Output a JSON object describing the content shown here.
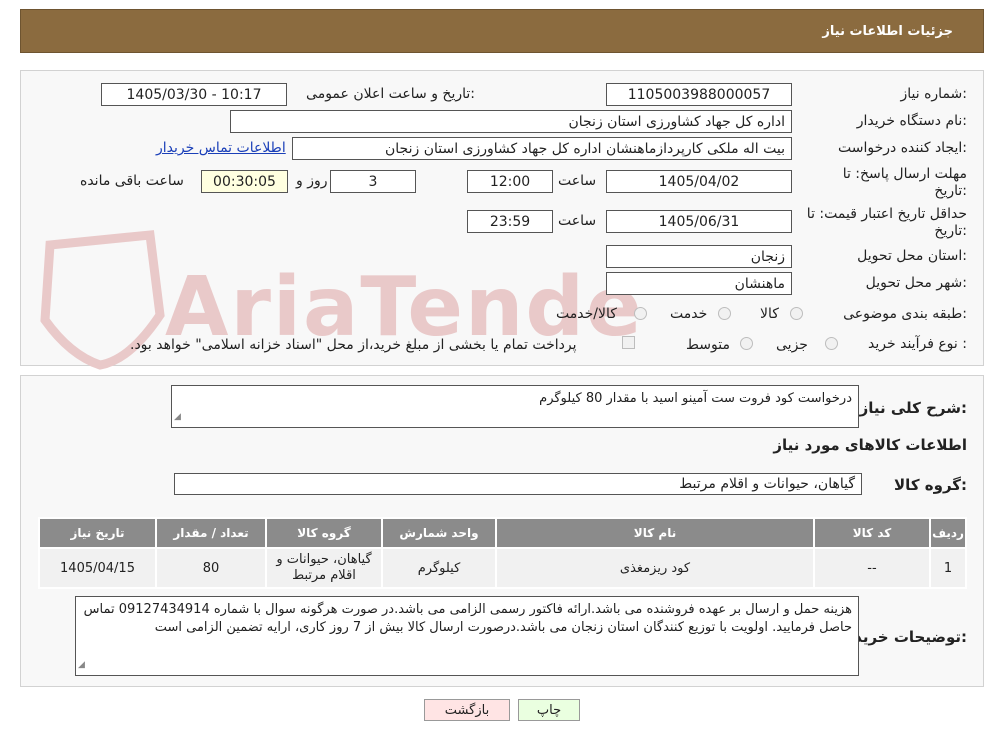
{
  "header": {
    "title": "جزئیات اطلاعات نیاز"
  },
  "watermark": {
    "text": "AriaTender.neT"
  },
  "fields": {
    "need_number_label": "شماره نیاز:",
    "need_number": "1105003988000057",
    "announce_label": "تاریخ و ساعت اعلان عمومی:",
    "announce_value": "1405/03/30 - 10:17",
    "buyer_org_label": "نام دستگاه خریدار:",
    "buyer_org": "اداره کل جهاد کشاورزی استان زنجان",
    "creator_label": "ایجاد کننده درخواست:",
    "creator": "بیت اله ملکی کارپردازماهنشان اداره کل جهاد کشاورزی استان زنجان",
    "buyer_contact_link": "اطلاعات تماس خریدار",
    "deadline_label_1": "مهلت ارسال پاسخ: تا",
    "deadline_label_2": "تاریخ:",
    "deadline_date": "1405/04/02",
    "time_label": "ساعت",
    "deadline_time": "12:00",
    "days_value": "3",
    "days_label": "روز و",
    "remaining_time": "00:30:05",
    "remaining_label": "ساعت باقی مانده",
    "price_valid_label_1": "حداقل تاریخ اعتبار قیمت: تا",
    "price_valid_label_2": "تاریخ:",
    "price_valid_date": "1405/06/31",
    "price_valid_time": "23:59",
    "province_label": "استان محل تحویل:",
    "province": "زنجان",
    "city_label": "شهر محل تحویل:",
    "city": "ماهنشان",
    "category_label": "طبقه بندی موضوعی:",
    "category_options": [
      "کالا",
      "خدمت",
      "کالا/خدمت"
    ],
    "process_label": "نوع فرآیند خرید :",
    "process_options": [
      "جزیی",
      "متوسط"
    ],
    "treasury_note": "پرداخت تمام یا بخشی از مبلغ خرید،از محل \"اسناد خزانه اسلامی\" خواهد بود."
  },
  "description": {
    "label": "شرح کلی نیاز:",
    "text": "درخواست کود فروت ست آمینو اسید با مقدار 80 کیلوگرم"
  },
  "goods": {
    "section_title": "اطلاعات کالاهای مورد نیاز",
    "group_label": "گروه کالا:",
    "group_value": "گیاهان، حیوانات و اقلام مرتبط",
    "columns": [
      "ردیف",
      "کد کالا",
      "نام کالا",
      "واحد شمارش",
      "گروه کالا",
      "تعداد / مقدار",
      "تاریخ نیاز"
    ],
    "rows": [
      [
        "1",
        "--",
        "کود ریزمغذی",
        "کیلوگرم",
        "گیاهان، حیوانات و اقلام مرتبط",
        "80",
        "1405/04/15"
      ]
    ]
  },
  "buyer_notes": {
    "label": "توضیحات خریدار:",
    "text": "هزینه حمل و ارسال بر عهده فروشنده می باشد.ارائه فاکتور رسمی الزامی می باشد.در صورت هرگونه سوال با شماره 09127434914 تماس حاصل فرمایید. اولویت با توزیع کنندگان استان زنجان می باشد.درصورت ارسال کالا بیش از 7 روز کاری، ارایه تضمین الزامی است"
  },
  "buttons": {
    "print": "چاپ",
    "back": "بازگشت"
  },
  "colors": {
    "header": "#8b6b3f",
    "table_header": "#8b8b8b",
    "back_button": "#ffe4e4",
    "print_button": "#eaffe0"
  }
}
